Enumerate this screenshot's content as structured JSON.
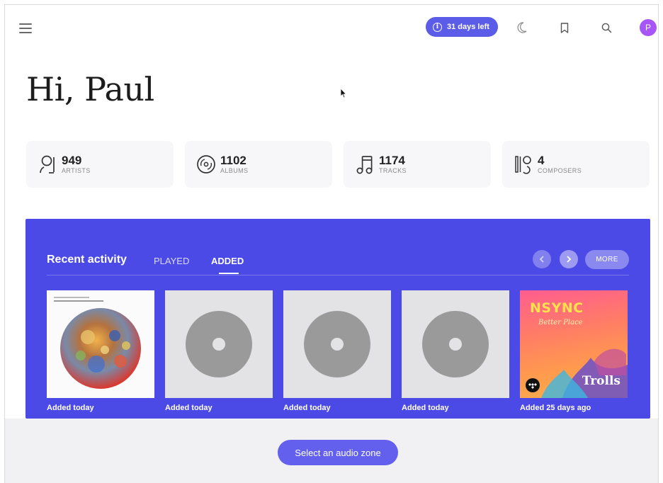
{
  "header": {
    "trial_label": "31 days left",
    "avatar_initial": "P",
    "icons": [
      "menu-icon",
      "info-icon",
      "moon-icon",
      "bookmark-icon",
      "search-icon"
    ]
  },
  "greeting": "Hi, Paul",
  "stats": [
    {
      "value": "949",
      "label": "ARTISTS",
      "icon": "artist-icon"
    },
    {
      "value": "1102",
      "label": "ALBUMS",
      "icon": "album-icon"
    },
    {
      "value": "1174",
      "label": "TRACKS",
      "icon": "track-icon"
    },
    {
      "value": "4",
      "label": "COMPOSERS",
      "icon": "composer-icon"
    }
  ],
  "recent": {
    "title": "Recent activity",
    "tabs": [
      {
        "label": "PLAYED",
        "active": false
      },
      {
        "label": "ADDED",
        "active": true
      }
    ],
    "more_label": "MORE",
    "items": [
      {
        "caption": "Added today",
        "cover": "artwork"
      },
      {
        "caption": "Added today",
        "cover": "placeholder"
      },
      {
        "caption": "Added today",
        "cover": "placeholder"
      },
      {
        "caption": "Added today",
        "cover": "placeholder"
      },
      {
        "caption": "Added 25 days ago",
        "cover": "nsync-trolls",
        "art_text": "NSYNC",
        "art_sub": "Better Place",
        "art_text2": "Trolls"
      }
    ]
  },
  "audio_zone_button": "Select an audio zone",
  "colors": {
    "accent": "#4c4ae6",
    "button": "#6360ee",
    "avatar": "#a855f7"
  }
}
